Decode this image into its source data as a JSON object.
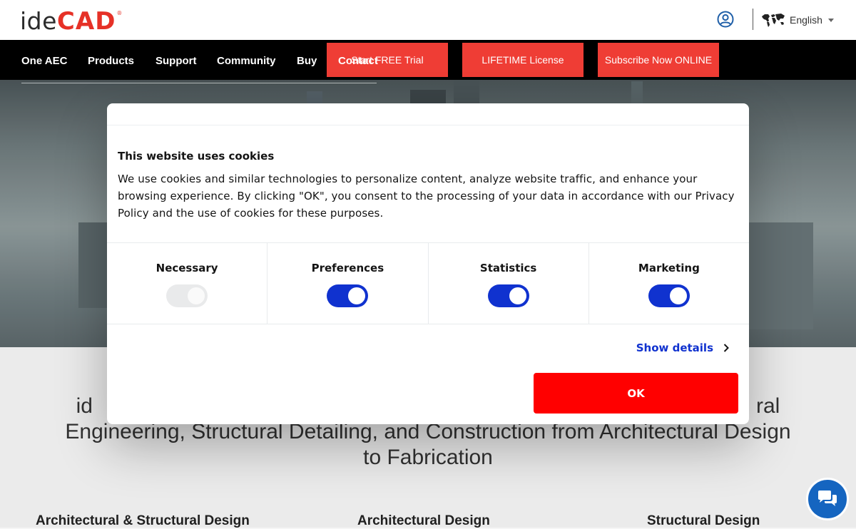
{
  "header": {
    "logo": {
      "part1": "ide",
      "part2": "CAD",
      "mark": "®"
    },
    "account_icon": "user-circle-icon",
    "language": {
      "label": "English",
      "icon": "world-map-icon"
    }
  },
  "nav": {
    "items": [
      "One AEC",
      "Products",
      "Support",
      "Community",
      "Buy",
      "Contact"
    ],
    "cta": [
      "Start FREE Trial",
      "LIFETIME License",
      "Subscribe Now ONLINE"
    ]
  },
  "page": {
    "headline_line1_left": "id",
    "headline_line1_right": "ral",
    "headline_line2": "Engineering, Structural Detailing, and Construction from Architectural Design",
    "headline_line3": "to Fabrication",
    "columns": [
      "Architectural & Structural Design",
      "Architectural Design",
      "Structural Design"
    ]
  },
  "cookie_dialog": {
    "title": "This website uses cookies",
    "body": "We use cookies and similar technologies to personalize content, analyze website traffic, and enhance your browsing experience. By clicking \"OK\", you consent to the processing of your data in accordance with our Privacy Policy and the use of cookies for these purposes.",
    "categories": [
      {
        "label": "Necessary",
        "enabled": true,
        "locked": true
      },
      {
        "label": "Preferences",
        "enabled": true,
        "locked": false
      },
      {
        "label": "Statistics",
        "enabled": true,
        "locked": false
      },
      {
        "label": "Marketing",
        "enabled": true,
        "locked": false
      }
    ],
    "show_details": "Show details",
    "ok_label": "OK"
  },
  "colors": {
    "brand_red": "#e63127",
    "cta_red": "#ef3d35",
    "toggle_blue": "#1032cf",
    "ok_red": "#ff0000",
    "chat_blue": "#1565c0"
  },
  "chat_icon": "chat-bubbles-icon"
}
